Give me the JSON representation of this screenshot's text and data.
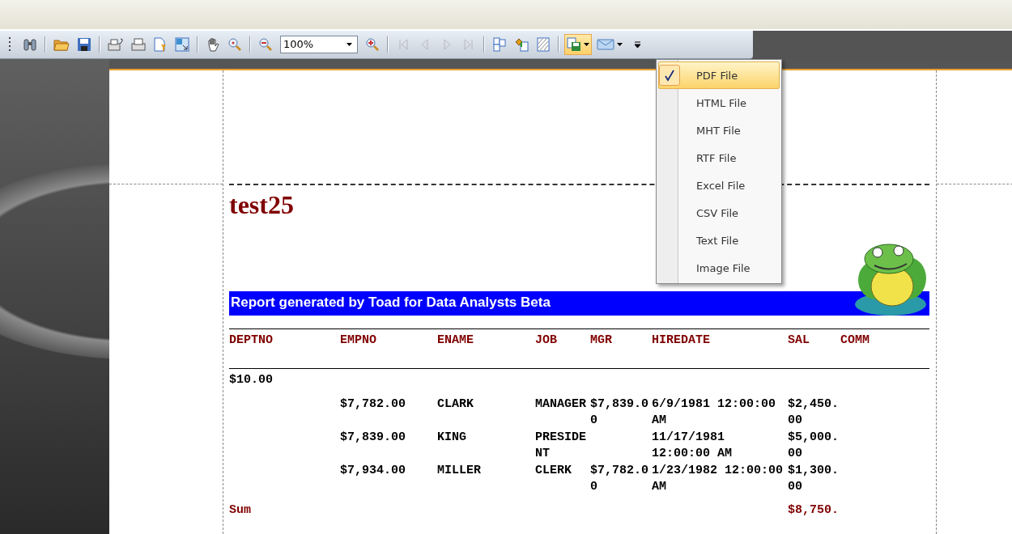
{
  "toolbar": {
    "groups": [
      [
        {
          "kind": "find",
          "disabled": false,
          "active": false
        }
      ],
      [
        {
          "kind": "open",
          "disabled": false,
          "active": false
        },
        {
          "kind": "save",
          "disabled": false,
          "active": false
        }
      ],
      [
        {
          "kind": "print-dialog",
          "disabled": false,
          "active": false
        },
        {
          "kind": "print",
          "disabled": false,
          "active": false
        },
        {
          "kind": "page-setup",
          "disabled": false,
          "active": false
        },
        {
          "kind": "scale",
          "disabled": false,
          "active": false
        }
      ],
      [
        {
          "kind": "hand",
          "disabled": false,
          "active": false
        },
        {
          "kind": "magnifier",
          "disabled": false,
          "active": false
        }
      ],
      [
        {
          "kind": "zoom-out",
          "disabled": false,
          "active": false
        },
        {
          "kind": "zoom",
          "value": "100%",
          "disabled": false,
          "active": false
        },
        {
          "kind": "zoom-in",
          "disabled": false,
          "active": false
        }
      ],
      [
        {
          "kind": "first",
          "disabled": true,
          "active": false
        },
        {
          "kind": "prev",
          "disabled": true,
          "active": false
        },
        {
          "kind": "next",
          "disabled": true,
          "active": false
        },
        {
          "kind": "last",
          "disabled": true,
          "active": false
        }
      ],
      [
        {
          "kind": "multipage",
          "disabled": false,
          "active": false
        },
        {
          "kind": "color",
          "disabled": false,
          "active": false
        },
        {
          "kind": "watermark",
          "disabled": false,
          "active": false
        }
      ],
      [
        {
          "kind": "export",
          "disabled": false,
          "active": true
        },
        {
          "kind": "email",
          "disabled": false,
          "active": false
        },
        {
          "kind": "overflow",
          "disabled": false,
          "active": false
        }
      ]
    ]
  },
  "export_menu": [
    {
      "label": "PDF File",
      "selected": true
    },
    {
      "label": "HTML File",
      "selected": false
    },
    {
      "label": "MHT File",
      "selected": false
    },
    {
      "label": "RTF File",
      "selected": false
    },
    {
      "label": "Excel File",
      "selected": false
    },
    {
      "label": "CSV File",
      "selected": false
    },
    {
      "label": "Text File",
      "selected": false
    },
    {
      "label": "Image File",
      "selected": false
    }
  ],
  "report": {
    "title": "test25",
    "banner": "Report generated by Toad for Data Analysts Beta",
    "columns": [
      "DEPTNO",
      "EMPNO",
      "ENAME",
      "JOB",
      "MGR",
      "HIREDATE",
      "SAL",
      "COMM"
    ],
    "group": "$10.00",
    "rows": [
      {
        "empno": "$7,782.00",
        "ename": "CLARK",
        "job": "MANAGER",
        "mgr": "$7,839.00",
        "hiredate": "6/9/1981 12:00:00 AM",
        "sal": "$2,450.00"
      },
      {
        "empno": "$7,839.00",
        "ename": "KING",
        "job": "PRESIDENT",
        "hiredate": "11/17/1981 12:00:00 AM",
        "sal": "$5,000.00"
      },
      {
        "empno": "$7,934.00",
        "ename": "MILLER",
        "job": "CLERK",
        "mgr": "$7,782.00",
        "hiredate": "1/23/1982 12:00:00 AM",
        "sal": "$1,300.00"
      }
    ],
    "summary": {
      "label": "Sum",
      "sal": "$8,750."
    }
  }
}
